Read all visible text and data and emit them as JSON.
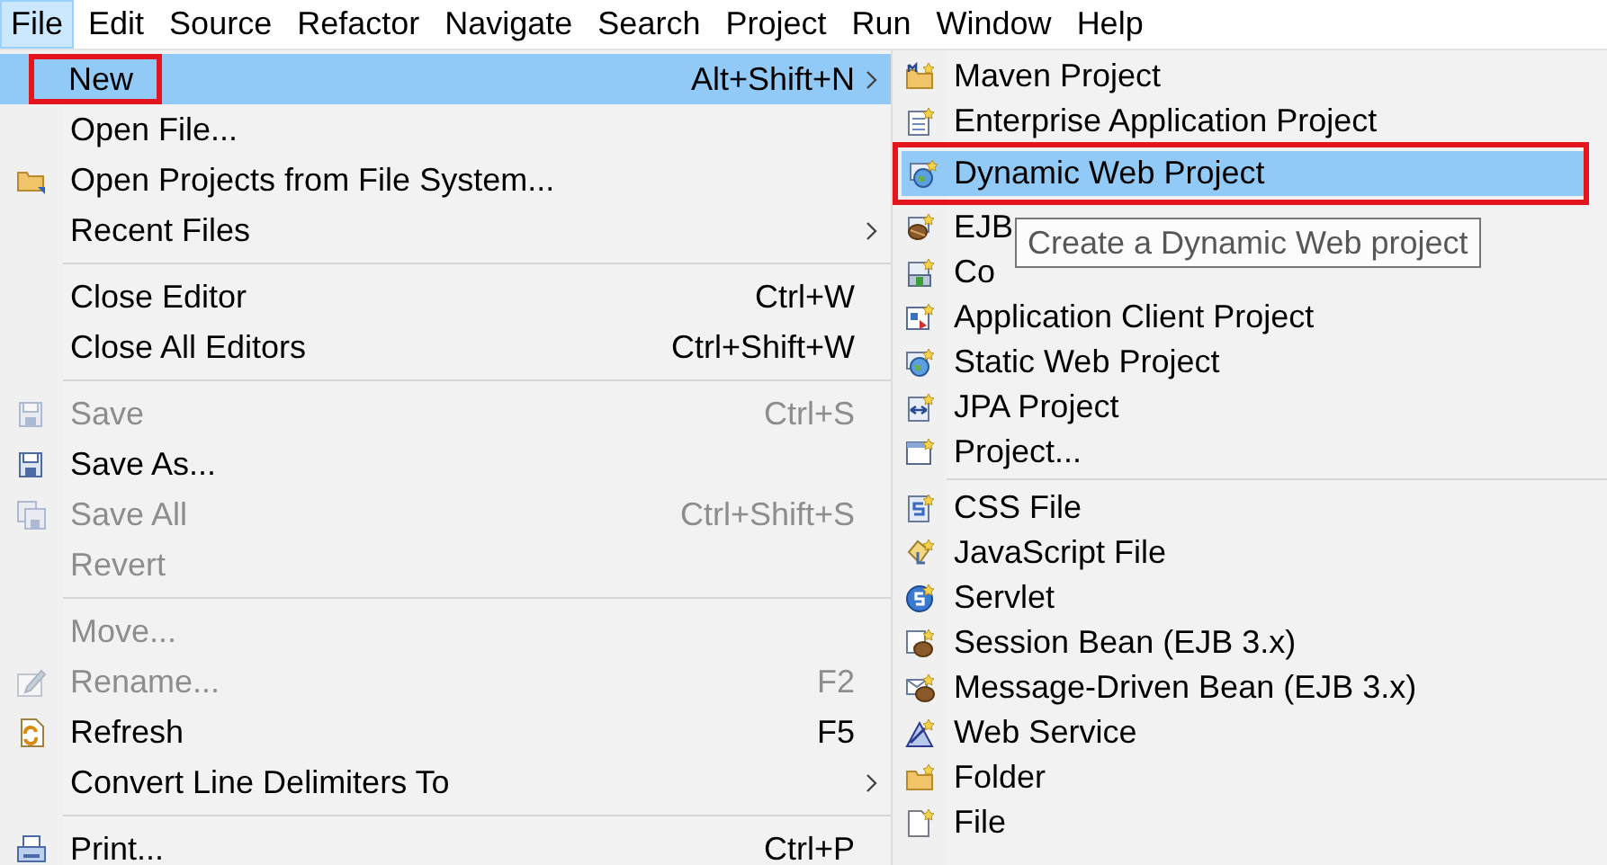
{
  "menu_bar": [
    {
      "label": "File",
      "selected": true
    },
    {
      "label": "Edit",
      "selected": false
    },
    {
      "label": "Source",
      "selected": false
    },
    {
      "label": "Refactor",
      "selected": false
    },
    {
      "label": "Navigate",
      "selected": false
    },
    {
      "label": "Search",
      "selected": false
    },
    {
      "label": "Project",
      "selected": false
    },
    {
      "label": "Run",
      "selected": false
    },
    {
      "label": "Window",
      "selected": false
    },
    {
      "label": "Help",
      "selected": false
    }
  ],
  "file_menu": {
    "groups": [
      [
        {
          "label": "New",
          "shortcut": "Alt+Shift+N",
          "submenu": true,
          "disabled": false,
          "selected": true,
          "outlined": true
        },
        {
          "label": "Open File...",
          "submenu": false,
          "disabled": false,
          "selected": false,
          "outlined": false
        },
        {
          "label": "Open Projects from File System...",
          "submenu": false,
          "disabled": false,
          "selected": false,
          "outlined": false
        },
        {
          "label": "Recent Files",
          "submenu": true,
          "disabled": false,
          "selected": false,
          "outlined": false
        }
      ],
      [
        {
          "label": "Close Editor",
          "shortcut": "Ctrl+W",
          "submenu": false,
          "disabled": false,
          "selected": false,
          "outlined": false
        },
        {
          "label": "Close All Editors",
          "shortcut": "Ctrl+Shift+W",
          "submenu": false,
          "disabled": false,
          "selected": false,
          "outlined": false
        }
      ],
      [
        {
          "label": "Save",
          "shortcut": "Ctrl+S",
          "submenu": false,
          "disabled": true,
          "selected": false,
          "outlined": false
        },
        {
          "label": "Save As...",
          "submenu": false,
          "disabled": false,
          "selected": false,
          "outlined": false
        },
        {
          "label": "Save All",
          "shortcut": "Ctrl+Shift+S",
          "submenu": false,
          "disabled": true,
          "selected": false,
          "outlined": false
        },
        {
          "label": "Revert",
          "submenu": false,
          "disabled": true,
          "selected": false,
          "outlined": false
        }
      ],
      [
        {
          "label": "Move...",
          "submenu": false,
          "disabled": true,
          "selected": false,
          "outlined": false
        },
        {
          "label": "Rename...",
          "shortcut": "F2",
          "submenu": false,
          "disabled": true,
          "selected": false,
          "outlined": false
        },
        {
          "label": "Refresh",
          "shortcut": "F5",
          "submenu": false,
          "disabled": false,
          "selected": false,
          "outlined": false
        },
        {
          "label": "Convert Line Delimiters To",
          "submenu": true,
          "disabled": false,
          "selected": false,
          "outlined": false
        }
      ],
      [
        {
          "label": "Print...",
          "shortcut": "Ctrl+P",
          "submenu": false,
          "disabled": false,
          "selected": false,
          "outlined": false
        }
      ]
    ]
  },
  "new_submenu": {
    "groups": [
      [
        {
          "label": "Maven Project",
          "selected": false,
          "outlined": false
        },
        {
          "label": "Enterprise Application Project",
          "selected": false,
          "outlined": false
        },
        {
          "label": "Dynamic Web Project",
          "selected": true,
          "outlined": true
        },
        {
          "label": "EJB",
          "selected": false,
          "outlined": false
        },
        {
          "label": "Co",
          "selected": false,
          "outlined": false
        },
        {
          "label": "Application Client Project",
          "selected": false,
          "outlined": false
        },
        {
          "label": "Static Web Project",
          "selected": false,
          "outlined": false
        },
        {
          "label": "JPA Project",
          "selected": false,
          "outlined": false
        },
        {
          "label": "Project...",
          "selected": false,
          "outlined": false
        }
      ],
      [
        {
          "label": "CSS File",
          "selected": false,
          "outlined": false
        },
        {
          "label": "JavaScript File",
          "selected": false,
          "outlined": false
        },
        {
          "label": "Servlet",
          "selected": false,
          "outlined": false
        },
        {
          "label": "Session Bean (EJB 3.x)",
          "selected": false,
          "outlined": false
        },
        {
          "label": "Message-Driven Bean (EJB 3.x)",
          "selected": false,
          "outlined": false
        },
        {
          "label": "Web Service",
          "selected": false,
          "outlined": false
        },
        {
          "label": "Folder",
          "selected": false,
          "outlined": false
        },
        {
          "label": "File",
          "selected": false,
          "outlined": false
        }
      ]
    ]
  },
  "tooltip": {
    "text": "Create a Dynamic Web project"
  }
}
